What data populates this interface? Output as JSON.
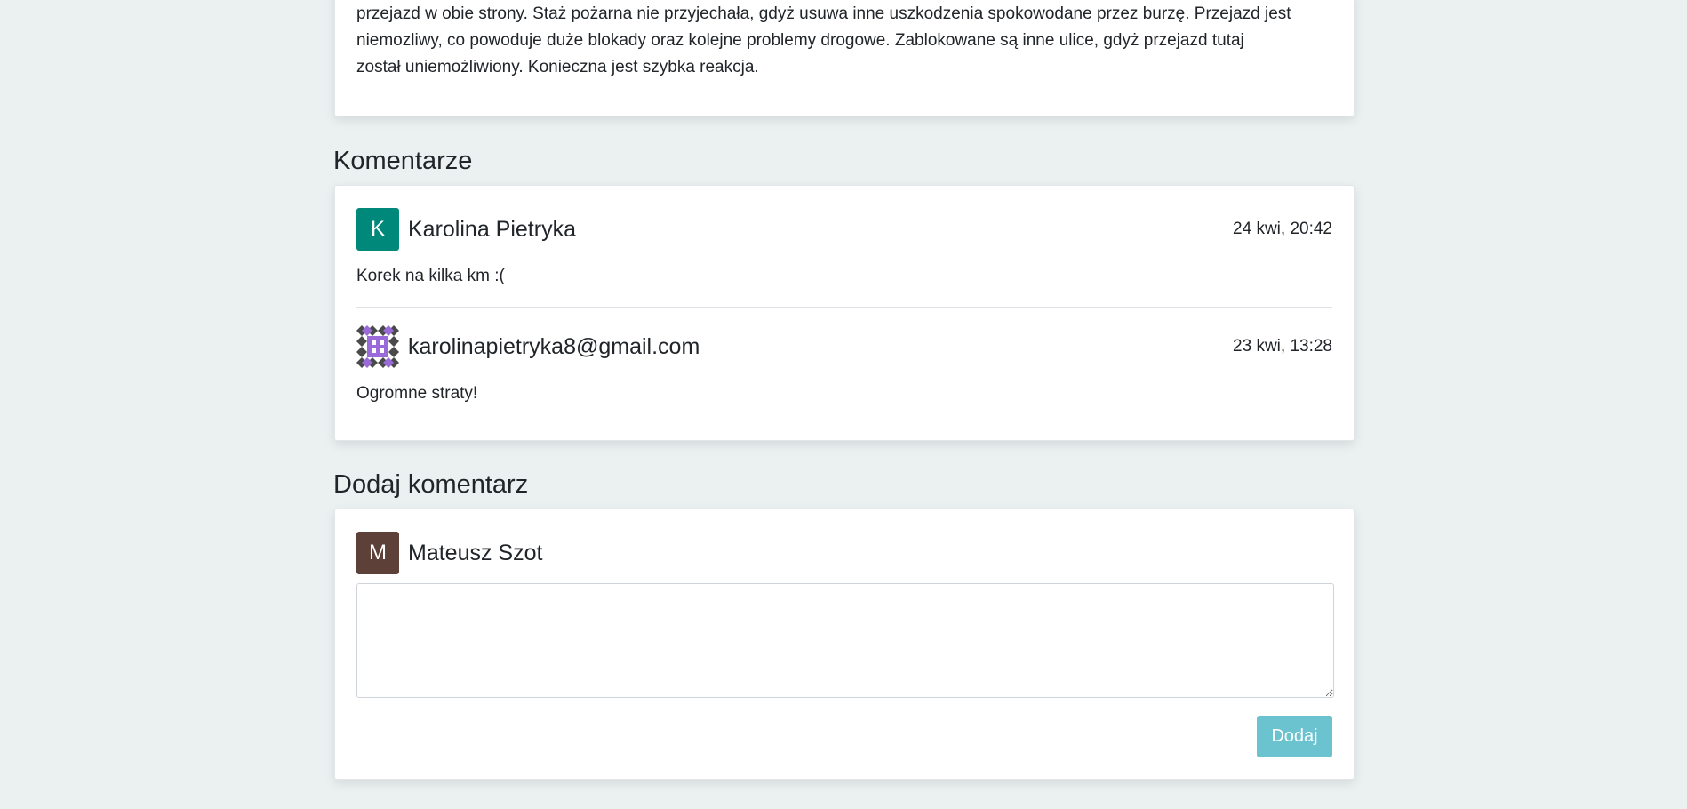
{
  "description": {
    "lines": [
      "przejazd w obie strony. Staż pożarna nie przyjechała, gdyż usuwa inne uszkodzenia spokowodane przez burzę. Przejazd jest",
      "niemozliwy, co powoduje duże blokady oraz kolejne problemy drogowe. Zablokowane są inne ulice, gdyż przejazd tutaj",
      "został uniemożliwiony. Konieczna jest szybka reakcja."
    ]
  },
  "comments_section": {
    "title": "Komentarze",
    "comments": [
      {
        "avatar_letter": "K",
        "avatar_color": "#00897b",
        "author": "Karolina Pietryka",
        "date": "24 kwi, 20:42",
        "text": "Korek na kilka km :("
      },
      {
        "avatar_icon": "identicon-avatar",
        "avatar_colors": [
          "#9a6bd8",
          "#4a4a4a"
        ],
        "author": "karolinapietryka8@gmail.com",
        "date": "23 kwi, 13:28",
        "text": "Ogromne straty!"
      }
    ]
  },
  "add_comment": {
    "title": "Dodaj komentarz",
    "avatar_letter": "M",
    "avatar_color": "#5d4037",
    "user": "Mateusz Szot",
    "textarea_value": "",
    "submit_label": "Dodaj",
    "submit_color": "#6cc3d0"
  }
}
